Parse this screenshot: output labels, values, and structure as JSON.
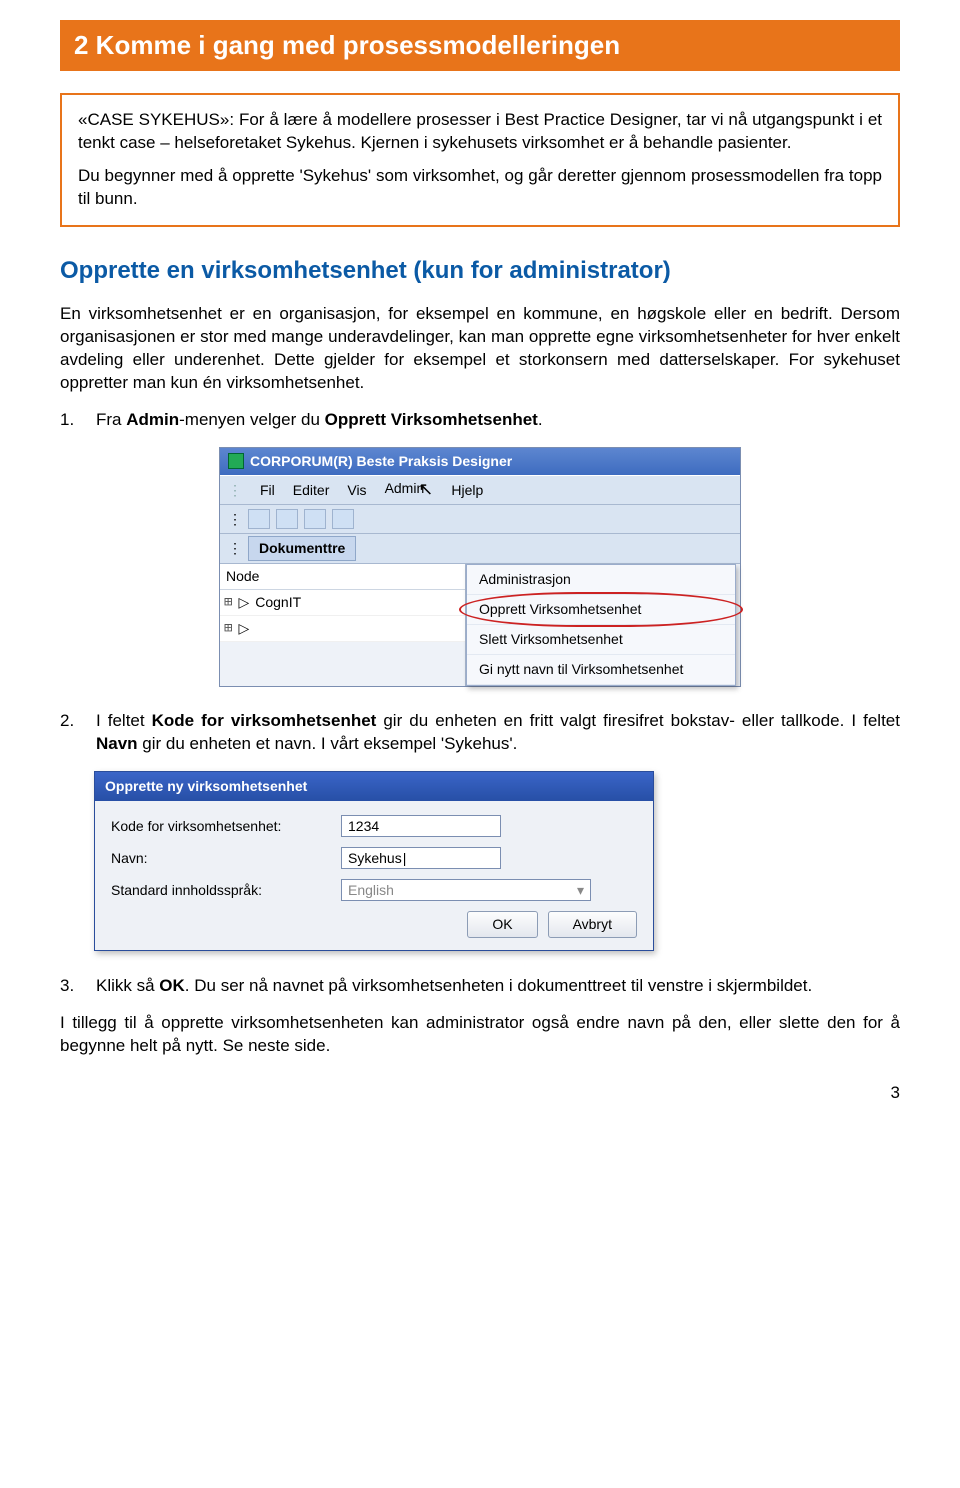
{
  "banner": "2 Komme i gang med prosessmodelleringen",
  "caseBox": {
    "p1": "«CASE SYKEHUS»: For å lære å modellere prosesser i Best Practice Designer, tar vi nå utgangspunkt i et tenkt case – helseforetaket Sykehus. Kjernen i sykehusets virksomhet er å behandle pasienter.",
    "p2": "Du begynner med å opprette 'Sykehus' som virksomhet, og går deretter gjennom prosessmodellen fra topp til bunn."
  },
  "subhead": "Opprette en virksomhetsenhet (kun for administrator)",
  "intro": "En virksomhetsenhet er en organisasjon, for eksempel en kommune, en høgskole eller en bedrift. Dersom organisasjonen er stor med mange underavdelinger, kan man opprette egne virksomhetsenheter for hver enkelt avdeling eller underenhet. Dette gjelder for eksempel et storkonsern med datterselskaper. For sykehuset oppretter man kun én virksomhetsenhet.",
  "steps": {
    "s1_num": "1.",
    "s1_pre": "Fra ",
    "s1_b1": "Admin",
    "s1_mid": "-menyen velger du ",
    "s1_b2": "Opprett Virksomhetsenhet",
    "s1_post": ".",
    "s2_num": "2.",
    "s2_pre": "I feltet ",
    "s2_b1": "Kode for virksomhetsenhet",
    "s2_mid1": " gir du enheten en fritt valgt firesifret bokstav- eller tallkode. I feltet ",
    "s2_b2": "Navn",
    "s2_mid2": " gir du enheten et navn. I vårt eksempel 'Sykehus'.",
    "s3_num": "3.",
    "s3_pre": "Klikk så ",
    "s3_b1": "OK",
    "s3_post": ". Du ser nå navnet på virksomhetsenheten i dokumenttreet til venstre i skjermbildet."
  },
  "closing": "I tillegg til å opprette virksomhetsenheten kan administrator også endre navn på den, eller slette den for å begynne helt på nytt. Se neste side.",
  "pageNumber": "3",
  "shot1": {
    "title": "CORPORUM(R) Beste Praksis Designer",
    "menus": {
      "fil": "Fil",
      "editer": "Editer",
      "vis": "Vis",
      "admin": "Admin",
      "hjelp": "Hjelp"
    },
    "tab": "Dokumenttre",
    "nodeHeader": "Node",
    "treeItem1": "CognIT",
    "dropdown": {
      "d1": "Administrasjon",
      "d2": "Opprett Virksomhetsenhet",
      "d3": "Slett Virksomhetsenhet",
      "d4": "Gi nytt navn til Virksomhetsenhet"
    }
  },
  "shot2": {
    "title": "Opprette ny virksomhetsenhet",
    "labels": {
      "kode": "Kode for virksomhetsenhet:",
      "navn": "Navn:",
      "lang": "Standard innholdsspråk:"
    },
    "values": {
      "kode": "1234",
      "navn": "Sykehus",
      "lang": "English"
    },
    "buttons": {
      "ok": "OK",
      "cancel": "Avbryt"
    }
  }
}
